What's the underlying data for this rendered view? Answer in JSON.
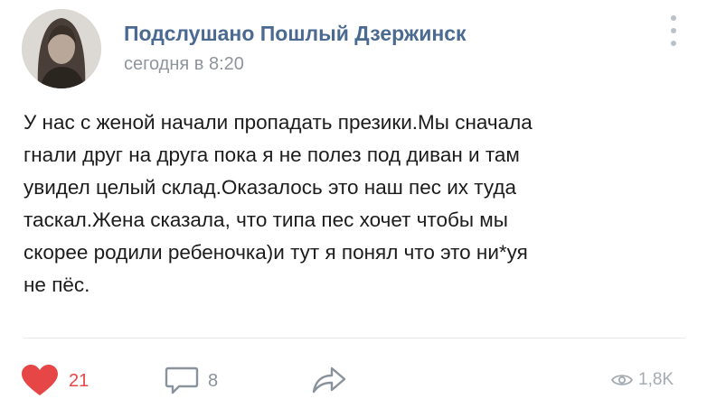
{
  "post": {
    "author": "Подслушано Пошлый Дзержинск",
    "time": "сегодня в 8:20",
    "text_lines": [
      "У нас с женой начали пропадать презики.Мы сначала",
      "гнали друг на друга пока я не полез под диван и там",
      "увидел целый склад.Оказалось это наш пес их туда",
      "таскал.Жена сказала, что типа пес хочет чтобы мы",
      "скорее родили ребеночка)и тут я понял что это ни*уя",
      "не пёс."
    ]
  },
  "actions": {
    "likes": "21",
    "comments": "8",
    "views": "1,8K"
  },
  "icons": {
    "like": "heart-icon",
    "comment": "comment-icon",
    "share": "share-icon",
    "views": "eye-icon",
    "menu": "more-vertical-icon"
  },
  "colors": {
    "author": "#4b6a91",
    "like_active": "#e64646",
    "muted": "#8f959c"
  }
}
